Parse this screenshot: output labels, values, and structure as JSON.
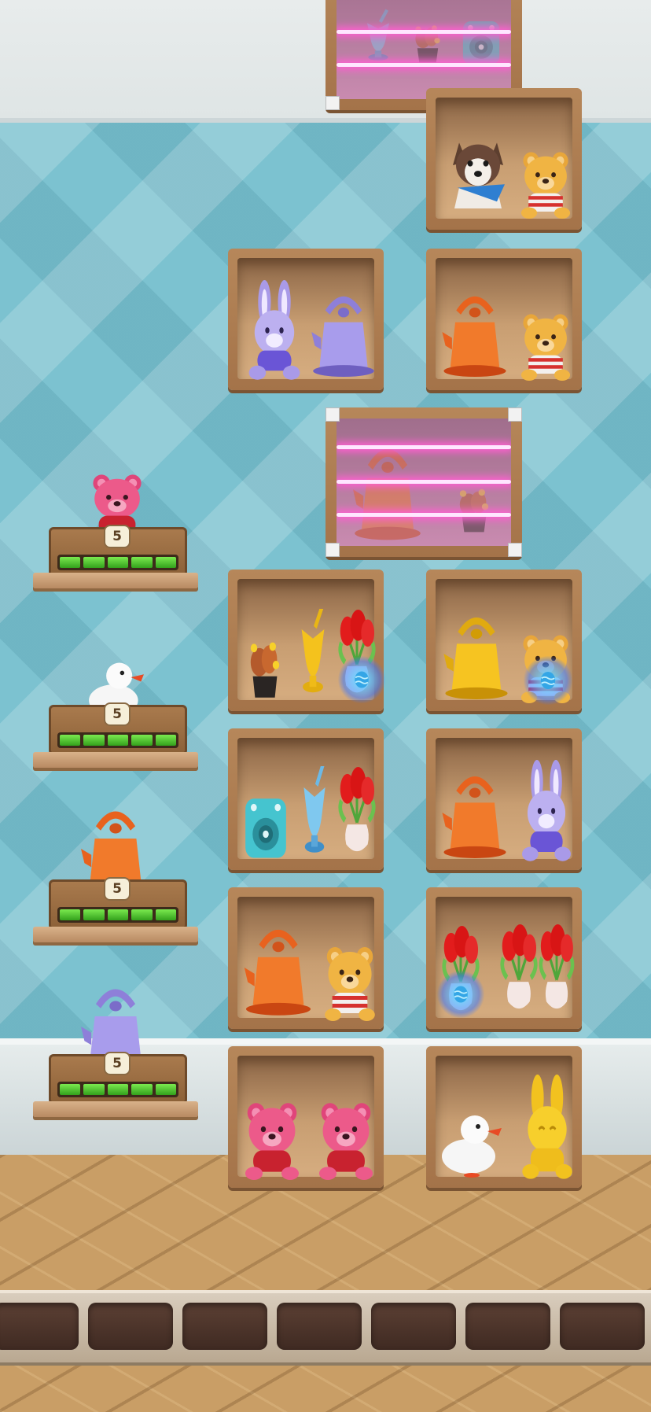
{
  "game": {
    "side_stations": [
      {
        "target_item": "pink-bear",
        "count": "5",
        "progress_filled": 5,
        "progress_total": 5
      },
      {
        "target_item": "white-duck",
        "count": "5",
        "progress_filled": 5,
        "progress_total": 5
      },
      {
        "target_item": "orange-kettle",
        "count": "5",
        "progress_filled": 5,
        "progress_total": 5
      },
      {
        "target_item": "purple-kettle",
        "count": "5",
        "progress_filled": 5,
        "progress_total": 5
      }
    ],
    "shelves": {
      "row1_right": [
        "husky-plush",
        "yellow-bear"
      ],
      "row2_left": [
        "purple-bunny",
        "purple-kettle"
      ],
      "row2_right": [
        "orange-kettle",
        "yellow-bear"
      ],
      "row3_left": [
        "flower-pot",
        "gold-vase",
        "red-tulips-egg"
      ],
      "row3_right": [
        "gold-kettle",
        "yellow-bear-egg"
      ],
      "row4_left": [
        "teal-speaker",
        "blue-vase",
        "red-tulips"
      ],
      "row4_right": [
        "orange-kettle",
        "purple-bunny"
      ],
      "row5_left": [
        "orange-kettle",
        "yellow-bear"
      ],
      "row5_right": [
        "red-tulips-egg",
        "red-tulips",
        "red-tulips"
      ],
      "row6_left": [
        "pink-bear",
        "pink-bear"
      ],
      "row6_right": [
        "white-duck",
        "gold-bunny"
      ]
    },
    "locked_boxes": [
      {
        "contents": [
          "blue-vase",
          "flower-pot",
          "teal-speaker"
        ]
      },
      {
        "contents": [
          "orange-kettle",
          "flower-pot"
        ]
      }
    ],
    "collection_tray_slots": 7,
    "colors": {
      "wall": "#7cc2d0",
      "floor": "#c99e66",
      "shelf_wood": "#b6875a",
      "progress_green": "#5fd23a",
      "laser": "#ff5fd2"
    }
  }
}
